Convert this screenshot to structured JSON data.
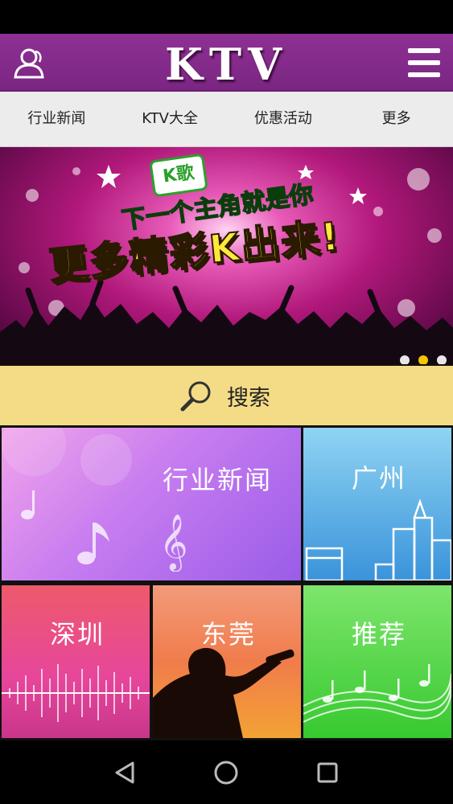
{
  "header": {
    "title": "KTV",
    "user_icon": "user-icon",
    "menu_icon": "menu-icon",
    "background": "#8e3094"
  },
  "tabs": [
    {
      "label": "行业新闻"
    },
    {
      "label": "KTV大全"
    },
    {
      "label": "优惠活动"
    },
    {
      "label": "更多"
    }
  ],
  "banner": {
    "badge": "K歌",
    "subtitle": "下一个主角就是你",
    "headline": "更多精彩K出来!",
    "slide_count": 3,
    "active_slide": 2
  },
  "search": {
    "label": "搜索",
    "icon": "search-icon",
    "background": "#f4dc86"
  },
  "tiles": [
    {
      "label": "行业新闻",
      "color": "#b56cf0"
    },
    {
      "label": "广州",
      "color": "#4a9fdf"
    },
    {
      "label": "深圳",
      "color": "#e7469b"
    },
    {
      "label": "东莞",
      "color": "#f07c4c"
    },
    {
      "label": "推荐",
      "color": "#37c930"
    }
  ],
  "navbar": {
    "back_icon": "back-icon",
    "home_icon": "home-icon",
    "recents_icon": "recents-icon"
  }
}
